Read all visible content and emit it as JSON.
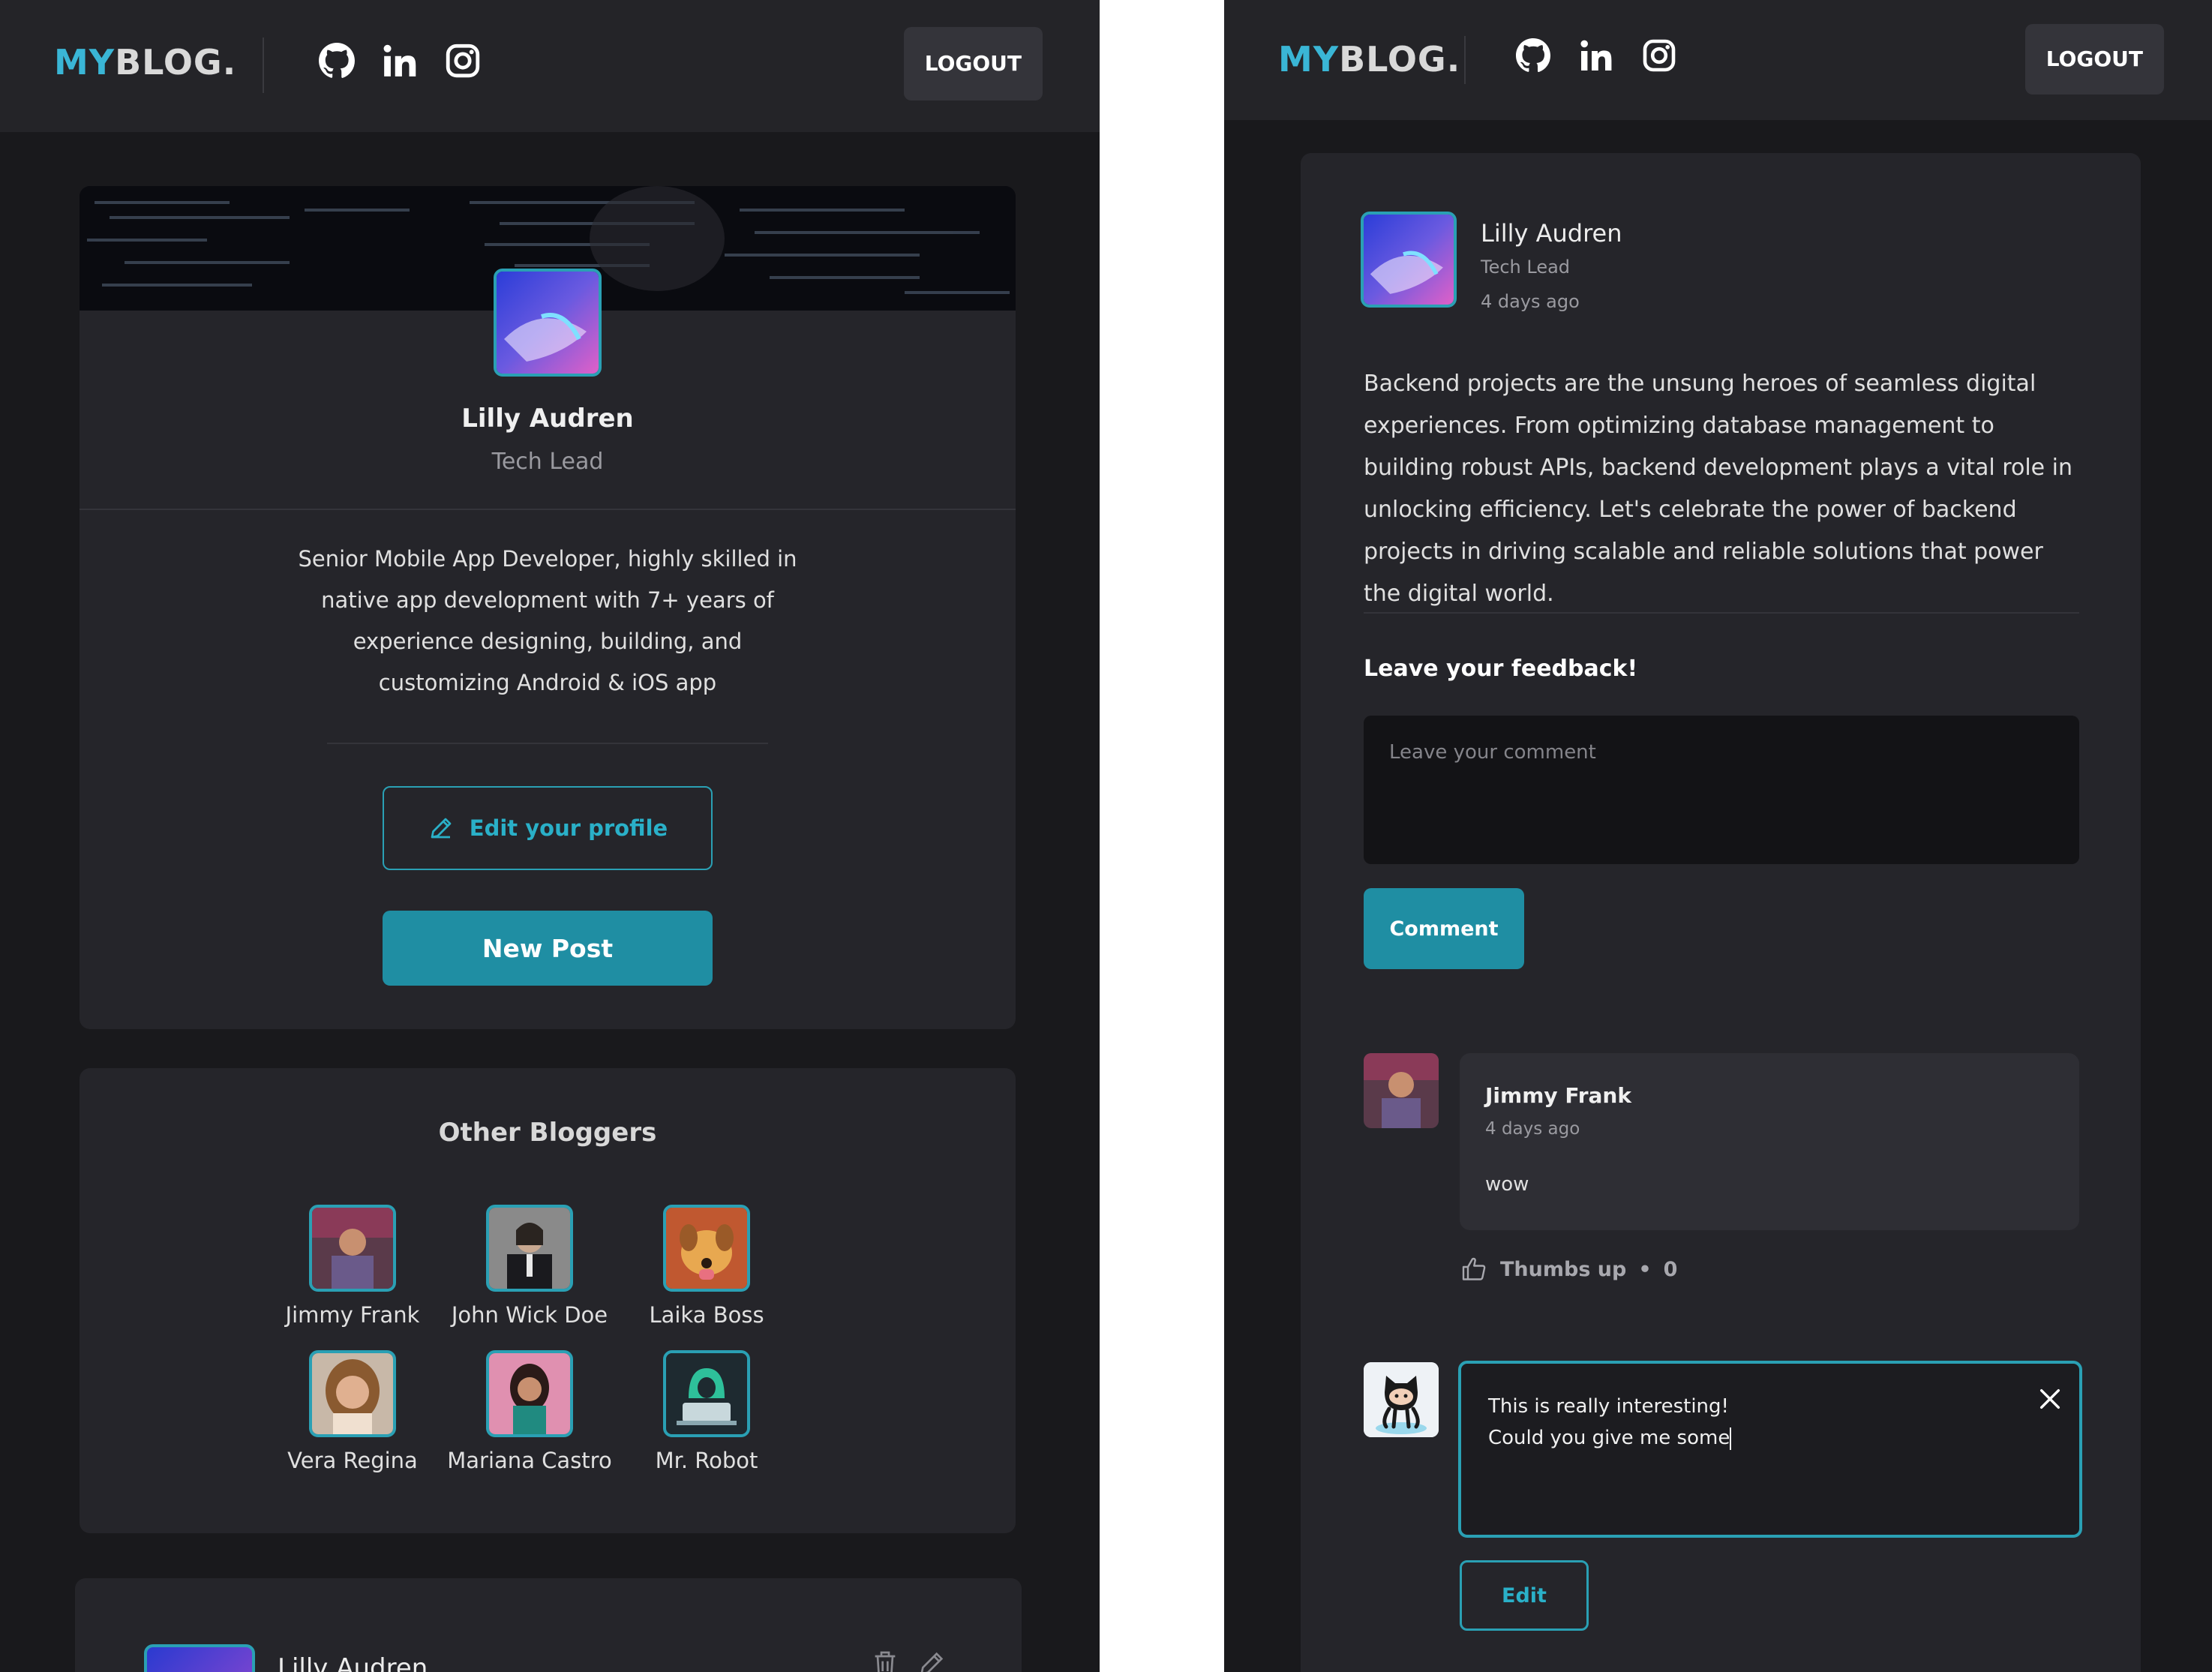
{
  "left": {
    "header": {
      "logo_my": "MY",
      "logo_blog": "BLOG.",
      "logout_label": "LOGOUT",
      "social_icons": [
        "github-icon",
        "linkedin-icon",
        "instagram-icon"
      ]
    },
    "profile": {
      "name": "Lilly Audren",
      "role": "Tech Lead",
      "bio": "Senior Mobile App Developer, highly skilled in native app development with 7+ years of experience designing, building, and customizing Android & iOS app",
      "edit_label": "Edit your profile",
      "new_post_label": "New Post"
    },
    "bloggers": {
      "title": "Other Bloggers",
      "items": [
        {
          "name": "Jimmy Frank"
        },
        {
          "name": "John Wick Doe"
        },
        {
          "name": "Laika Boss"
        },
        {
          "name": "Vera Regina"
        },
        {
          "name": "Mariana Castro"
        },
        {
          "name": "Mr. Robot"
        }
      ]
    },
    "post_peek": {
      "author": "Lilly Audren"
    }
  },
  "right": {
    "header": {
      "logo_my": "MY",
      "logo_blog": "BLOG.",
      "logout_label": "LOGOUT"
    },
    "post": {
      "author": "Lilly Audren",
      "role": "Tech Lead",
      "time": "4 days ago",
      "body": "Backend projects are the unsung heroes of seamless digital experiences. From optimizing database management to building robust APIs, backend development plays a vital role in unlocking efficiency. Let's celebrate the power of backend projects in driving scalable and reliable solutions that power the digital world."
    },
    "feedback": {
      "title": "Leave your feedback!",
      "placeholder": "Leave your comment",
      "button_label": "Comment"
    },
    "comment": {
      "name": "Jimmy Frank",
      "time": "4 days ago",
      "text": "wow",
      "thumbs_label": "Thumbs up",
      "thumbs_sep": "•",
      "thumbs_count": "0"
    },
    "editing": {
      "line1": "This is really interesting!",
      "line2": "Could you give me some",
      "edit_label": "Edit"
    }
  },
  "colors": {
    "accent": "#2aa0b4",
    "button": "#1f8ea3",
    "bg": "#19191c",
    "card": "#25252a"
  }
}
